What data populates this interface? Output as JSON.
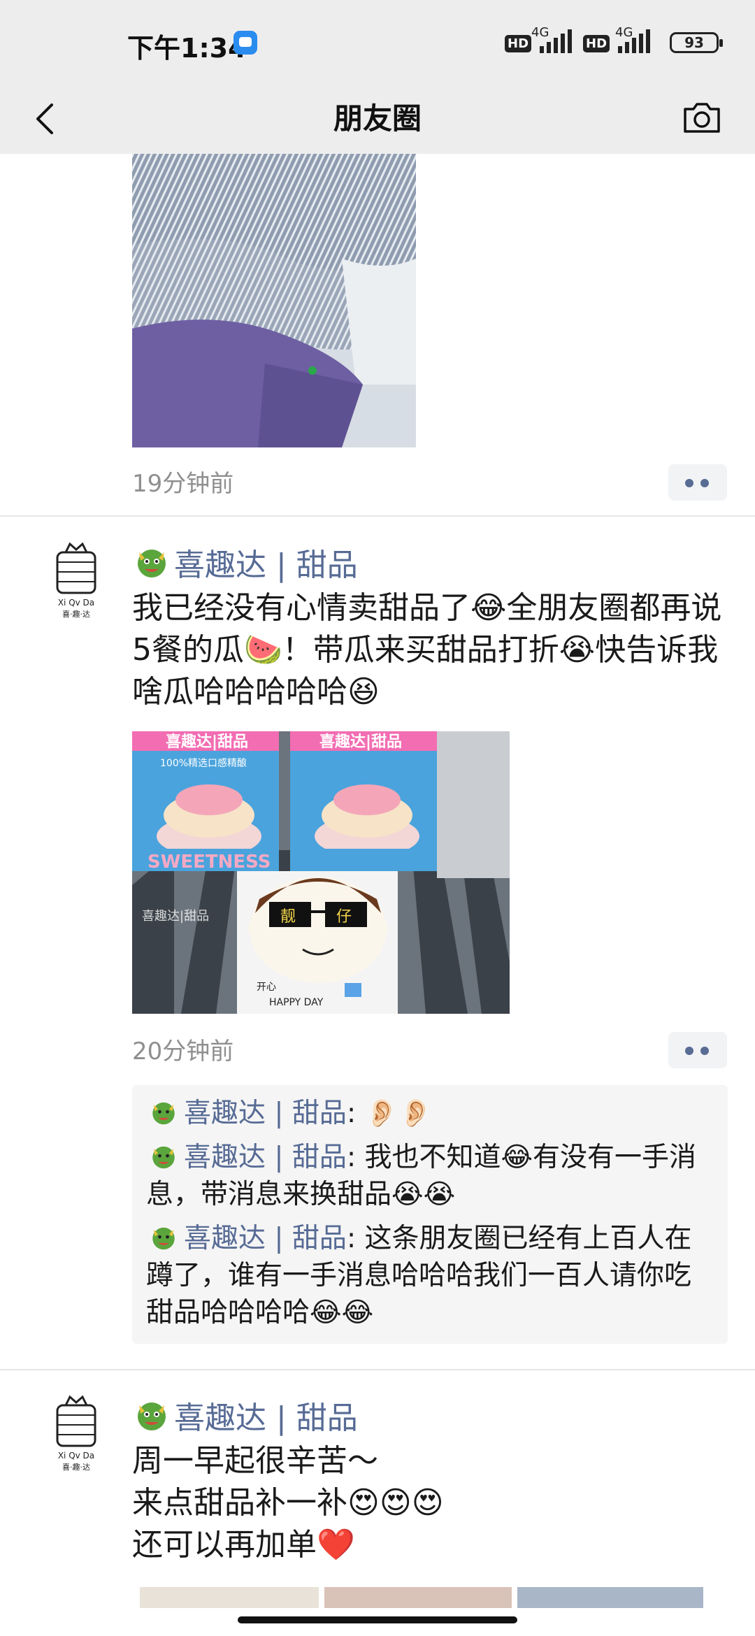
{
  "status_bar": {
    "time": "下午1:34",
    "network_1": "4G",
    "network_2": "4G",
    "hd_1": "HD",
    "hd_2": "HD",
    "battery": "93"
  },
  "nav": {
    "title": "朋友圈",
    "back_icon": "chevron-left-icon",
    "camera_icon": "camera-icon"
  },
  "prev_post": {
    "time": "19分钟前"
  },
  "post1": {
    "name": "喜趣达 | 甜品",
    "avatar_text": "Xi Qv Da",
    "avatar_cn": "喜·趣·达",
    "text": "我已经没有心情卖甜品了😂全朋友圈都再说5餐的瓜🍉！带瓜来买甜品打折😭快告诉我啥瓜哈哈哈哈哈😆",
    "time": "20分钟前",
    "image_labels": {
      "left_banner": "喜趣达|甜品",
      "right_banner": "喜趣达|甜品",
      "tagline": "100%精选口感精酿",
      "box_text": "SWEETNESS",
      "watermark": "喜趣达|甜品",
      "topper_left": "靓",
      "topper_right": "仔",
      "card_line1": "开心",
      "card_line2": "HAPPY DAY"
    },
    "comments": [
      {
        "name": "喜趣达 | 甜品",
        "text": ": 👂🏻👂🏻"
      },
      {
        "name": "喜趣达 | 甜品",
        "text": ": 我也不知道😂有没有一手消息，带消息来换甜品😭😭"
      },
      {
        "name": "喜趣达 | 甜品",
        "text": ": 这条朋友圈已经有上百人在蹲了，谁有一手消息哈哈哈我们一百人请你吃甜品哈哈哈哈😂😂"
      }
    ]
  },
  "post2": {
    "name": "喜趣达 | 甜品",
    "avatar_text": "Xi Qv Da",
    "avatar_cn": "喜·趣·达",
    "text": "周一早起很辛苦～\n来点甜品补一补😍😍😍\n还可以再加单❤️"
  },
  "colors": {
    "name_blue": "#576b95",
    "header_bg": "#ededed",
    "comment_bg": "#f5f5f5",
    "timestamp_gray": "#8f8f8f"
  }
}
